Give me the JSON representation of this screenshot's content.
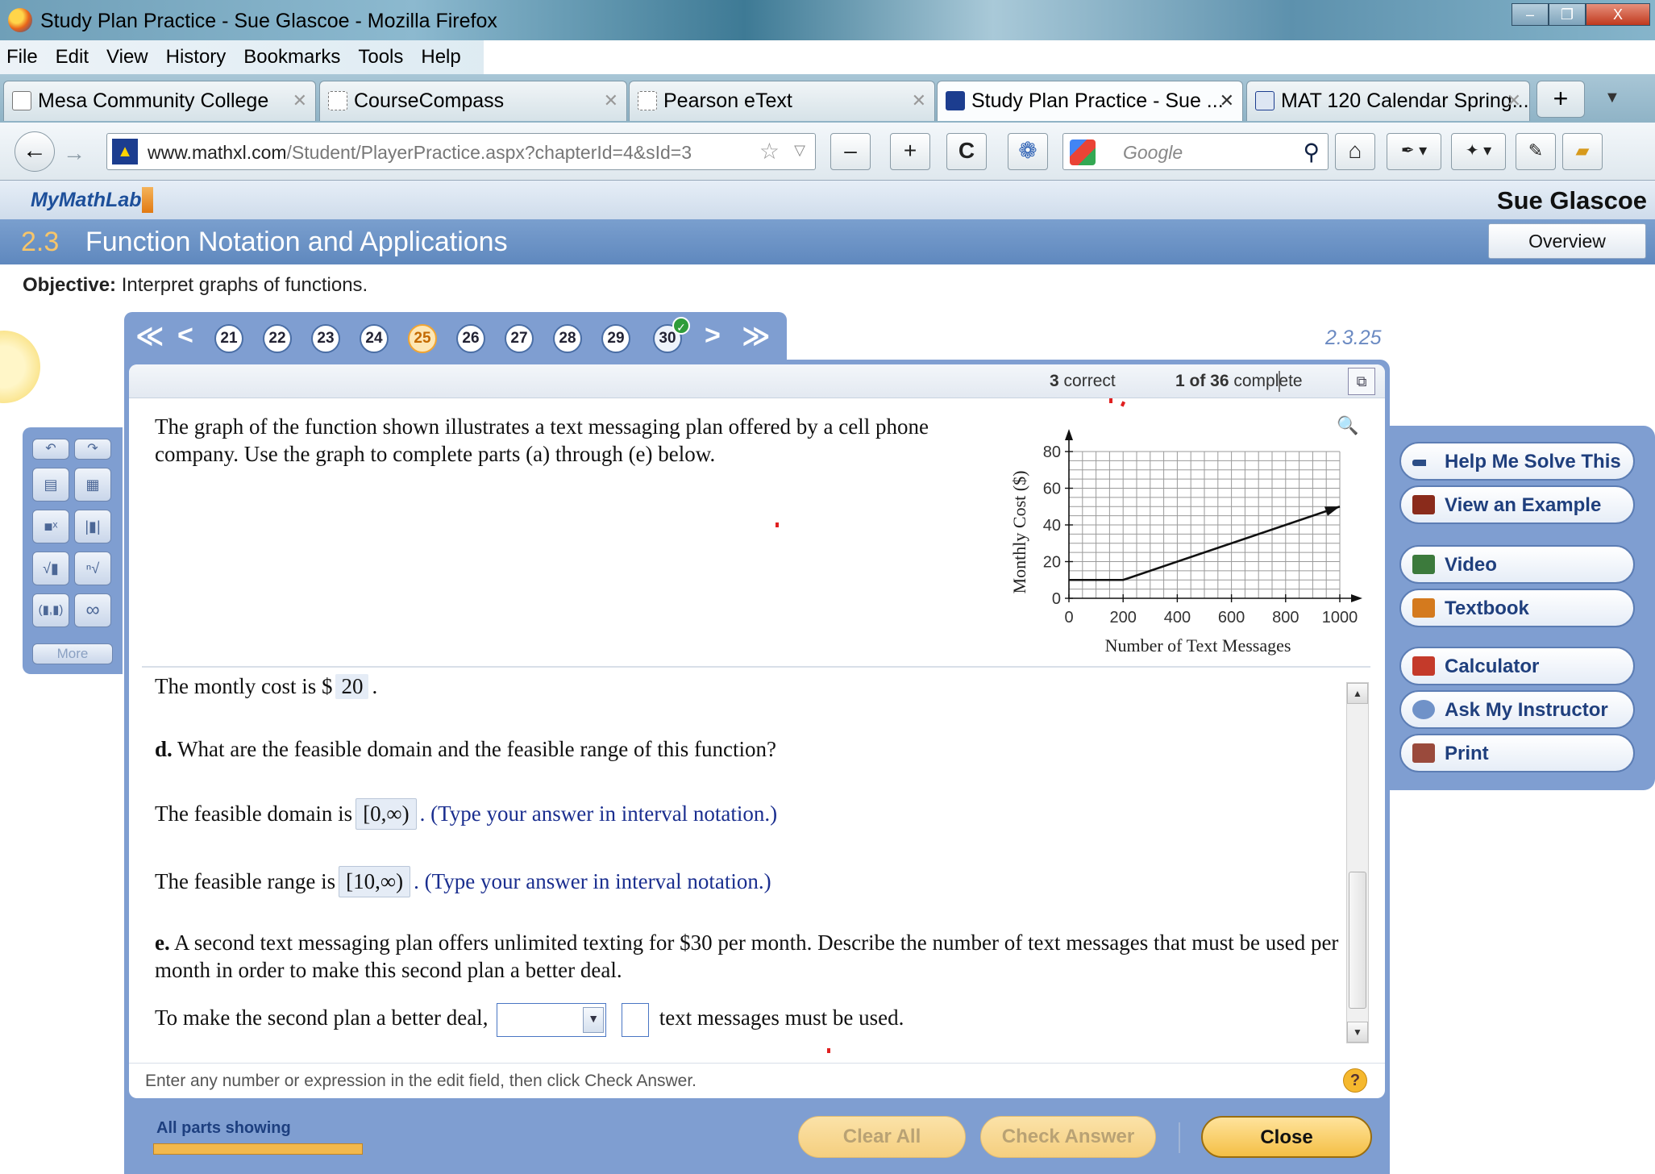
{
  "window": {
    "title": "Study Plan Practice - Sue Glascoe - Mozilla Firefox",
    "controls": [
      "–",
      "❐",
      "X"
    ]
  },
  "menu": [
    "File",
    "Edit",
    "View",
    "History",
    "Bookmarks",
    "Tools",
    "Help"
  ],
  "tabs": [
    {
      "label": "Mesa Community College"
    },
    {
      "label": "CourseCompass"
    },
    {
      "label": "Pearson eText"
    },
    {
      "label": "Study Plan Practice - Sue ...",
      "active": true
    },
    {
      "label": "MAT 120 Calendar Spring..."
    }
  ],
  "toolbar": {
    "url_domain": "www.mathxl.com",
    "url_path": "/Student/PlayerPractice.aspx?chapterId=4&sId=3",
    "search_placeholder": "Google",
    "zoom_out": "–",
    "zoom_in": "+",
    "reload": "C",
    "new_tab": "+"
  },
  "app": {
    "logo": "MyMathLab",
    "user": "Sue Glascoe",
    "overview": "Overview"
  },
  "section": {
    "number": "2.3",
    "title": "Function Notation and Applications"
  },
  "objective": {
    "label": "Objective:",
    "text": "Interpret graphs of functions."
  },
  "question_nav": {
    "numbers": [
      "21",
      "22",
      "23",
      "24",
      "25",
      "26",
      "27",
      "28",
      "29",
      "30"
    ],
    "current": "25",
    "completed": "30",
    "question_id": "2.3.25"
  },
  "status": {
    "correct_count": "3",
    "correct_label": "correct",
    "progress": "1 of 36",
    "progress_label": "complete"
  },
  "question": {
    "intro": "The graph of the function shown illustrates a text messaging plan offered by a cell phone company. Use the graph to complete parts (a) through (e) below.",
    "cost_text": "The montly cost is $",
    "cost_value": "20",
    "d_label": "d.",
    "d_text": "What are the feasible domain and the feasible range of this function?",
    "domain_text": "The feasible domain is",
    "domain_value": "[0,∞)",
    "range_text": "The feasible range is",
    "range_value": "[10,∞)",
    "interval_hint": ". (Type your answer in interval notation.)",
    "e_label": "e.",
    "e_text": "A second text messaging plan offers unlimited texting for $30 per month. Describe the number of text messages that must be used per month in order to make this second plan a better deal.",
    "answer_prefix": "To make the second plan a better deal,",
    "answer_suffix": "text messages must be used."
  },
  "help_text": "Enter any number or expression in the edit field, then click Check Answer.",
  "bottom": {
    "parts_label": "All parts showing",
    "clear_all": "Clear All",
    "check_answer": "Check Answer",
    "close": "Close"
  },
  "side_buttons": [
    "Help Me Solve This",
    "View an Example",
    "Video",
    "Textbook",
    "Calculator",
    "Ask My Instructor",
    "Print"
  ],
  "palette": {
    "more": "More"
  },
  "chart_data": {
    "type": "line",
    "xlabel": "Number of Text Messages",
    "ylabel": "Monthly Cost ($)",
    "xlim": [
      0,
      1000
    ],
    "ylim": [
      0,
      80
    ],
    "xticks": [
      "0",
      "200",
      "400",
      "600",
      "800",
      "1000"
    ],
    "yticks": [
      "0",
      "20",
      "40",
      "60",
      "80"
    ],
    "grid": true,
    "series": [
      {
        "x": [
          0,
          200,
          1000
        ],
        "y": [
          10,
          10,
          50
        ],
        "arrow_end": true
      }
    ]
  }
}
